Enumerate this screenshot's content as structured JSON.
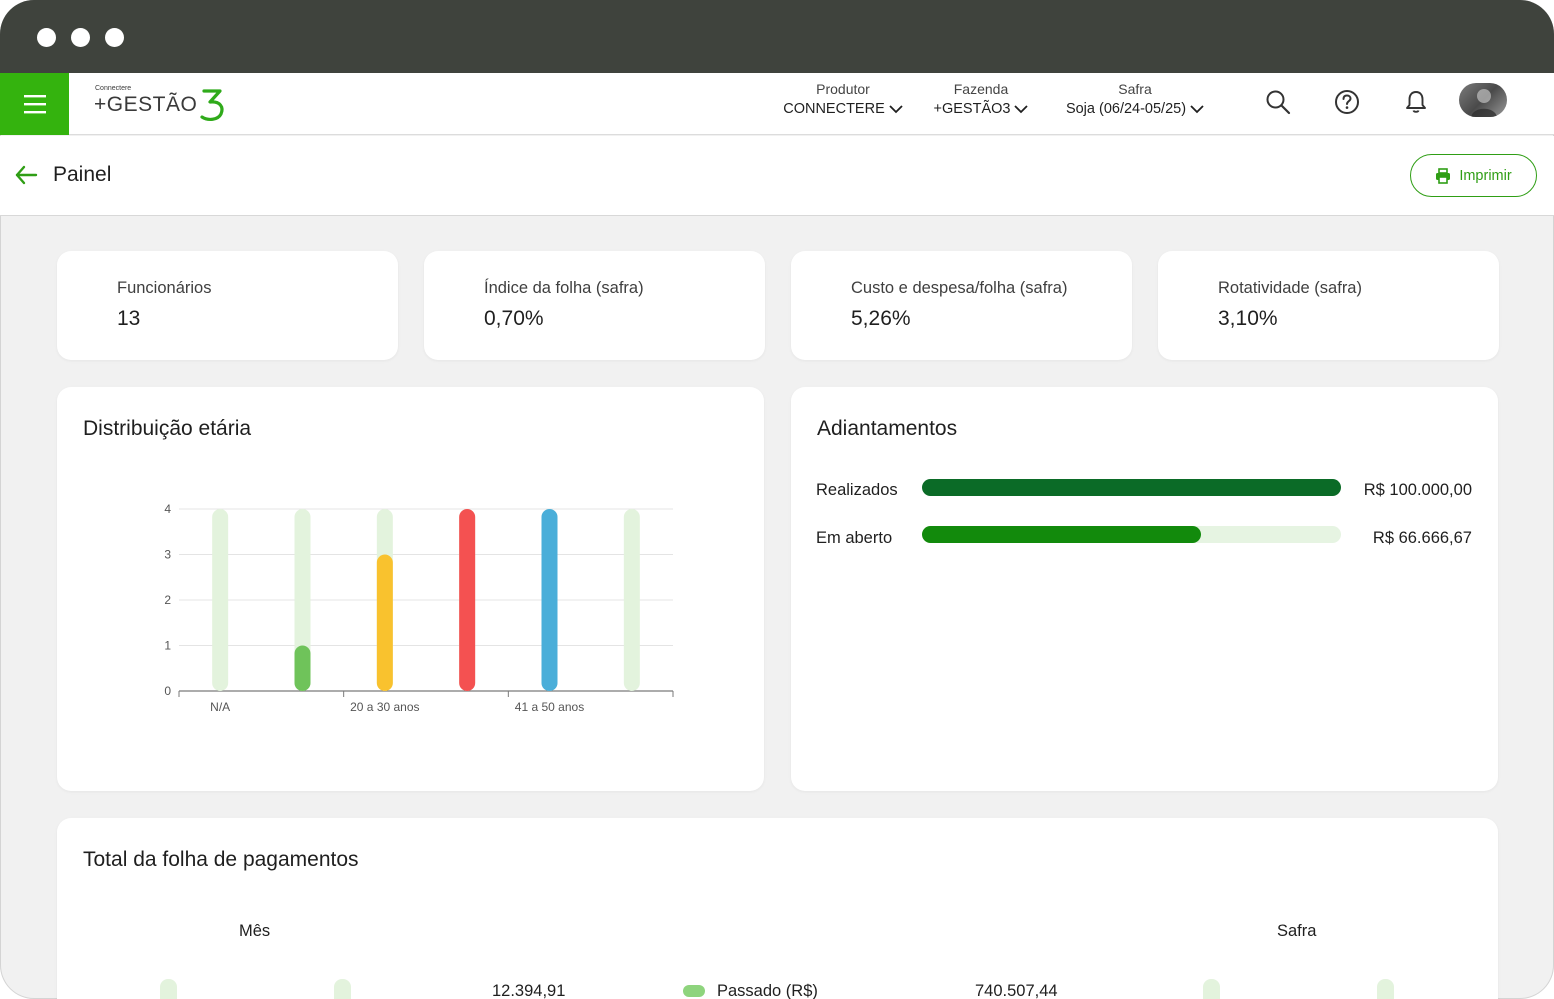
{
  "app": {
    "logo_small": "Connectere",
    "logo_text": "+GESTÃO"
  },
  "navbar": {
    "produtor": {
      "label": "Produtor",
      "value": "CONNECTERE"
    },
    "fazenda": {
      "label": "Fazenda",
      "value": "+GESTÃO3"
    },
    "safra": {
      "label": "Safra",
      "value": "Soja (06/24-05/25)"
    }
  },
  "header": {
    "title": "Painel",
    "print_label": "Imprimir"
  },
  "kpis": [
    {
      "label": "Funcionários",
      "value": "13"
    },
    {
      "label": "Índice da folha (safra)",
      "value": "0,70%"
    },
    {
      "label": "Custo e despesa/folha (safra)",
      "value": "5,26%"
    },
    {
      "label": "Rotatividade (safra)",
      "value": "3,10%"
    }
  ],
  "age_panel": {
    "title": "Distribuição etária"
  },
  "chart_data": {
    "type": "bar",
    "categories": [
      "N/A",
      "",
      "20 a 30 anos",
      "",
      "41 a 50 anos",
      ""
    ],
    "values": [
      0,
      1,
      3,
      4,
      4,
      0
    ],
    "colors": [
      "#d6eed0",
      "#6fc35a",
      "#f9c22e",
      "#f45151",
      "#4aaed9",
      "#d6eed0"
    ],
    "track_color": "#e3f3dd",
    "ylim": [
      0,
      4
    ],
    "yticks": [
      "0",
      "1",
      "2",
      "3",
      "4"
    ],
    "xtick_labels": [
      "N/A",
      "20 a 30 anos",
      "41 a 50 anos"
    ],
    "grid": true
  },
  "advances": {
    "title": "Adiantamentos",
    "rows": [
      {
        "label": "Realizados",
        "value": "R$ 100.000,00",
        "fraction": 1.0,
        "color": "#0b6b27"
      },
      {
        "label": "Em aberto",
        "value": "R$ 66.666,67",
        "fraction": 0.667,
        "color": "#128a0c"
      }
    ]
  },
  "payroll": {
    "title": "Total da folha de pagamentos",
    "col_month": "Mês",
    "col_safra": "Safra",
    "month_value": "12.394,91",
    "legend_past": "Passado (R$)",
    "safra_value": "740.507,44"
  }
}
